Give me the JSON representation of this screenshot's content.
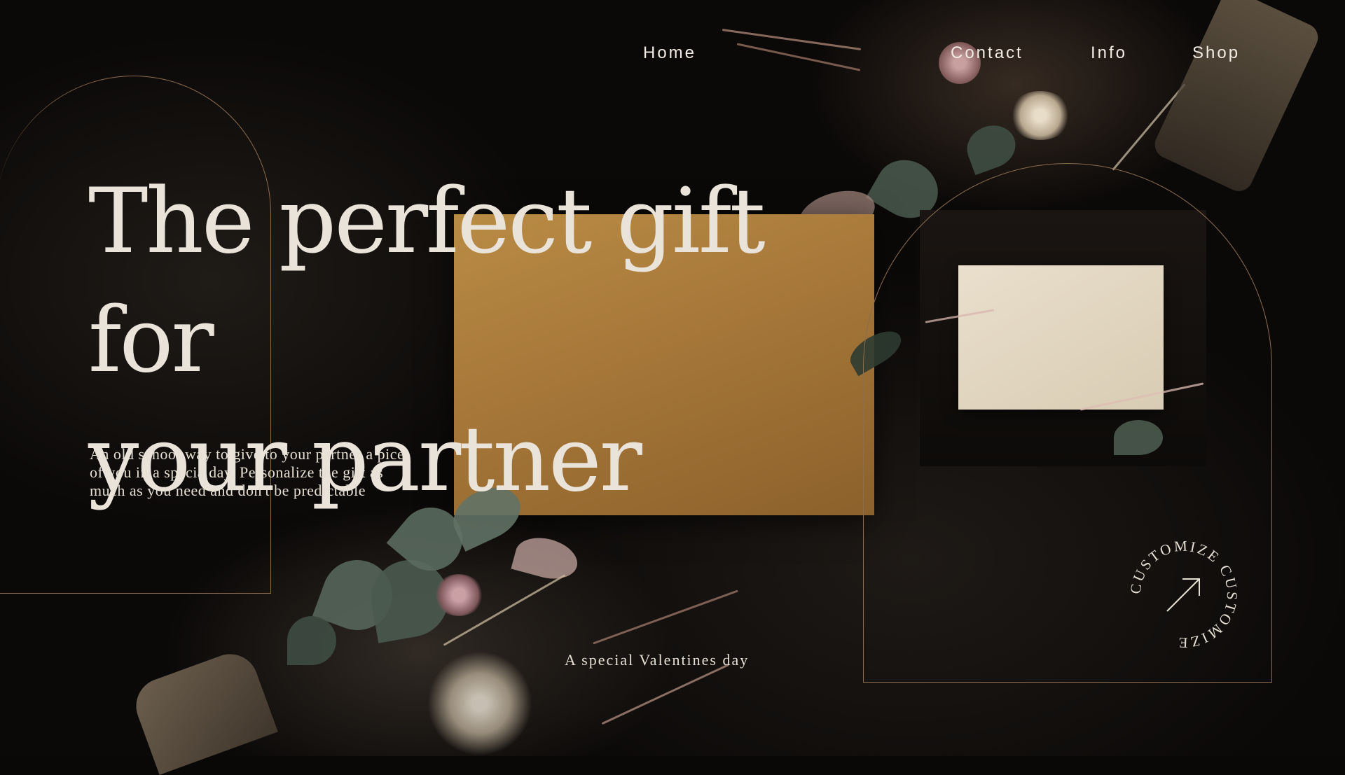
{
  "nav": {
    "items": [
      "Home",
      "Contact",
      "Info",
      "Shop"
    ]
  },
  "hero": {
    "headline_line1": "The perfect gift for",
    "headline_line2": "your partner",
    "description": "An old school way to give to your partner a pice of you in a specia day. Personalize the gift as much as you need and don't be predictable"
  },
  "tagline": "A special Valentines day",
  "badge": {
    "label": "CUSTOMIZE CUSTOMIZE",
    "icon": "arrow-up-right-icon"
  },
  "colors": {
    "background": "#0b0908",
    "envelope": "#a8793a",
    "card": "#e2d8c4",
    "arch_line": "#8c6d4f",
    "text": "#e9e3da"
  }
}
